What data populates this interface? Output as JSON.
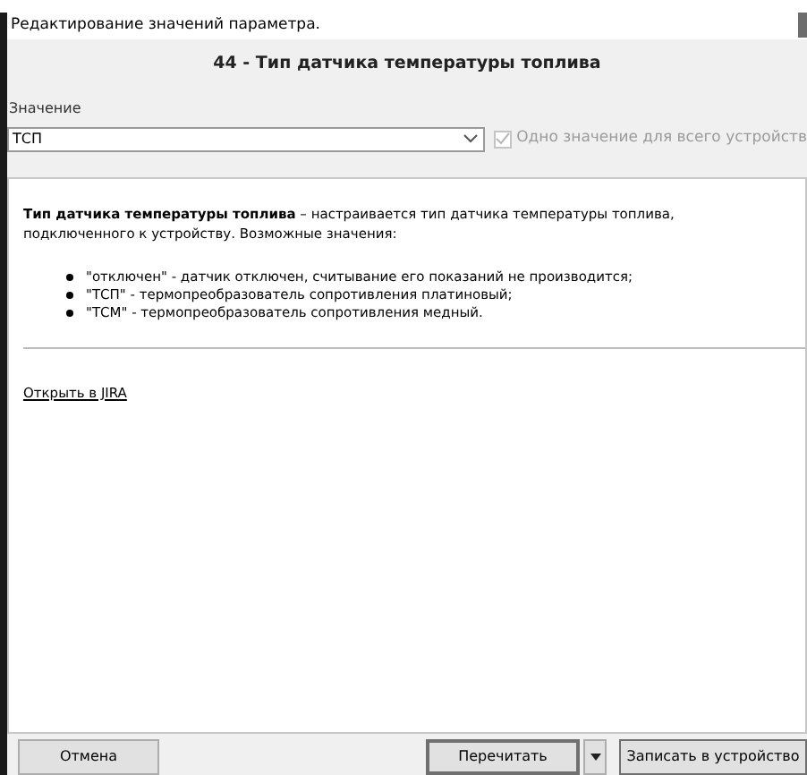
{
  "window": {
    "title": "Редактирование значений параметра."
  },
  "heading": "44 - Тип датчика температуры топлива",
  "value_field": {
    "label": "Значение",
    "value": "ТСП"
  },
  "same_for_device": {
    "label": "Одно значение для всего устройств",
    "checked": true,
    "disabled": true
  },
  "description": {
    "text": "**Тип датчика температуры топлива** – настраивается тип датчика температуры топлива, подключенного к устройству. Возможные значения:",
    "items": [
      "\"отключен\" - датчик отключен, считывание его показаний не производится;",
      "\"ТСП\" - термопреобразователь сопротивления платиновый;",
      "\"ТСМ\" - термопреобразователь сопротивления медный."
    ],
    "link": "Открыть в JIRA"
  },
  "buttons": {
    "cancel": "Отмена",
    "reread": "Перечитать",
    "write": "Записать в устройство"
  }
}
